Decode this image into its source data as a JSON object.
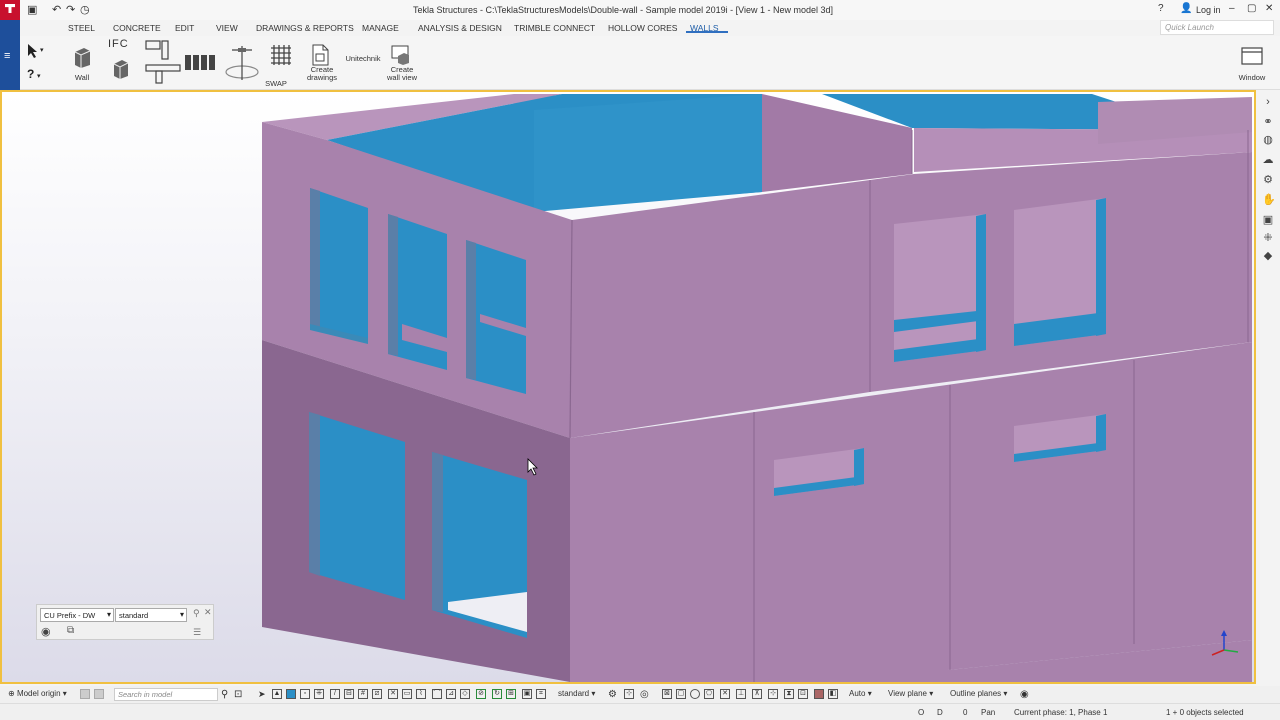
{
  "titlebar": {
    "title": "Tekla Structures - C:\\TeklaStructuresModels\\Double-wall - Sample model 2019i - [View 1 - New model 3d]",
    "login": "Log in",
    "help_icon": "help-icon",
    "minimize_icon": "minimize-icon",
    "maximize_icon": "maximize-icon",
    "close_icon": "close-icon"
  },
  "quick_access": {
    "save_icon": "save-icon",
    "undo_icon": "undo-icon",
    "redo_icon": "redo-icon",
    "history_icon": "history-icon"
  },
  "menu": {
    "items": [
      {
        "label": "STEEL"
      },
      {
        "label": "CONCRETE"
      },
      {
        "label": "EDIT"
      },
      {
        "label": "VIEW"
      },
      {
        "label": "DRAWINGS & REPORTS"
      },
      {
        "label": "MANAGE"
      },
      {
        "label": "ANALYSIS & DESIGN"
      },
      {
        "label": "TRIMBLE CONNECT"
      },
      {
        "label": "HOLLOW CORES"
      },
      {
        "label": "WALLS"
      }
    ],
    "active": "WALLS",
    "quick_launch_placeholder": "Quick Launch"
  },
  "ribbon": {
    "wall_label": "Wall",
    "ifc_label": "IFC",
    "swap_label": "SWAP",
    "create_drawings_label": "Create\ndrawings",
    "unitechnik_label": "Unitechnik",
    "create_wall_view_label": "Create\nwall view",
    "window_label": "Window"
  },
  "filter_panel": {
    "filter_value": "CU Prefix - DW",
    "view_value": "standard"
  },
  "bottom_toolbar": {
    "model_origin": "Model origin",
    "search_placeholder": "Search in model",
    "standard": "standard",
    "auto": "Auto",
    "view_plane": "View plane",
    "outline_planes": "Outline planes"
  },
  "status": {
    "o": "O",
    "d": "D",
    "zero": "0",
    "pan": "Pan",
    "phase": "Current phase: 1, Phase 1",
    "selected": "1 + 0 objects selected"
  },
  "colors": {
    "wall": "#a882ac",
    "wall_dark": "#8a6790",
    "wall_shadow": "#7d5d84",
    "opening": "#2b8fc6",
    "accent": "#1e4f9b",
    "viewport_border": "#f0c040"
  }
}
